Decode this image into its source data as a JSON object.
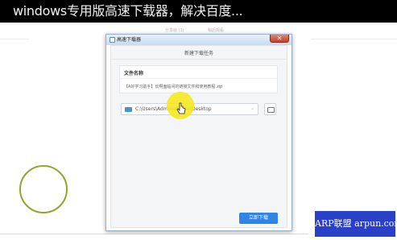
{
  "video": {
    "title": "windows专用版高速下载器，解决百度...",
    "subtitle_left": "分享给 (3)",
    "subtitle_right": "稍后观看"
  },
  "window": {
    "title": "高速下载器",
    "close_glyph": "✕"
  },
  "dialog": {
    "heading": "新建下载任务",
    "file_label": "文件名称",
    "file_name": "【A好学习助手】长啊面临间的链接文件和使用教程.zip",
    "save_path": "C:\\Users\\Administrator\\Desktop",
    "download_button": "立即下载"
  },
  "watermark": {
    "text": "ARP联盟 arpun.com"
  },
  "colors": {
    "accent": "#2f84e6",
    "highlight": "#f6e814",
    "circle": "#8ea82a",
    "watermark_bg": "#2b40c9"
  },
  "icons": [
    "app-icon",
    "close-icon",
    "folder-icon",
    "chevron-down-icon",
    "browse-folder-icon",
    "cursor-icon"
  ]
}
